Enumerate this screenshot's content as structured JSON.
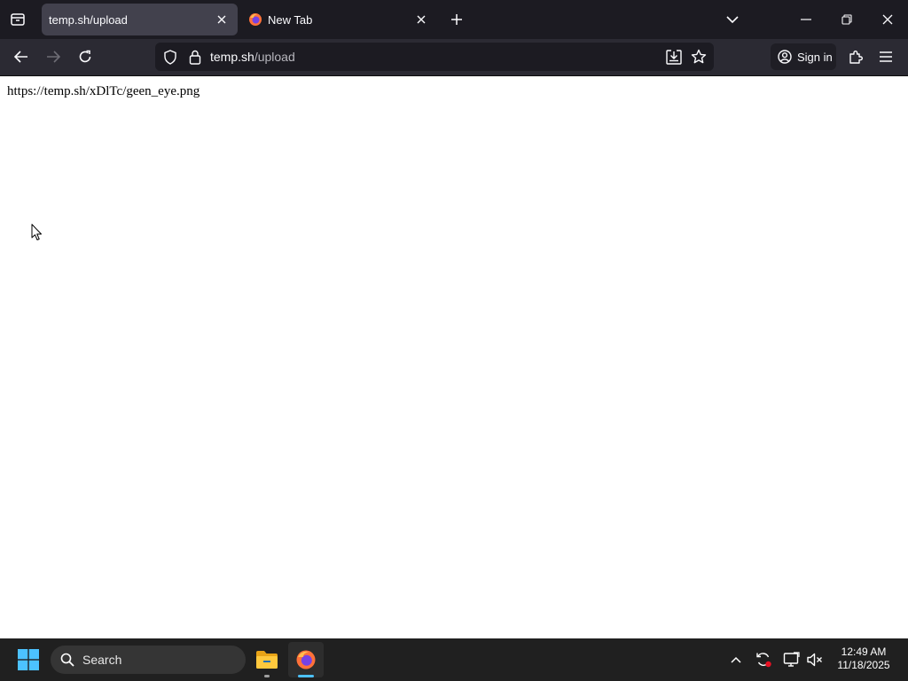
{
  "browser": {
    "tabs": [
      {
        "title": "temp.sh/upload",
        "active": true
      },
      {
        "title": "New Tab",
        "active": false
      }
    ],
    "url_host": "temp.sh",
    "url_path": "/upload",
    "signin_label": "Sign in",
    "icons": [
      "tab-list-icon",
      "close-icon",
      "firefox-icon",
      "new-tab-icon",
      "chevron-down-icon",
      "minimize-icon",
      "restore-icon",
      "window-close-icon",
      "back-icon",
      "forward-icon",
      "reload-icon",
      "shield-icon",
      "lock-icon",
      "download-icon",
      "star-icon",
      "account-icon",
      "extensions-icon",
      "menu-icon"
    ]
  },
  "page": {
    "result_url": "https://temp.sh/xDlTc/geen_eye.png"
  },
  "taskbar": {
    "search_label": "Search",
    "time": "12:49 AM",
    "date": "11/18/2025",
    "accent_color": "#4cc2ff"
  }
}
